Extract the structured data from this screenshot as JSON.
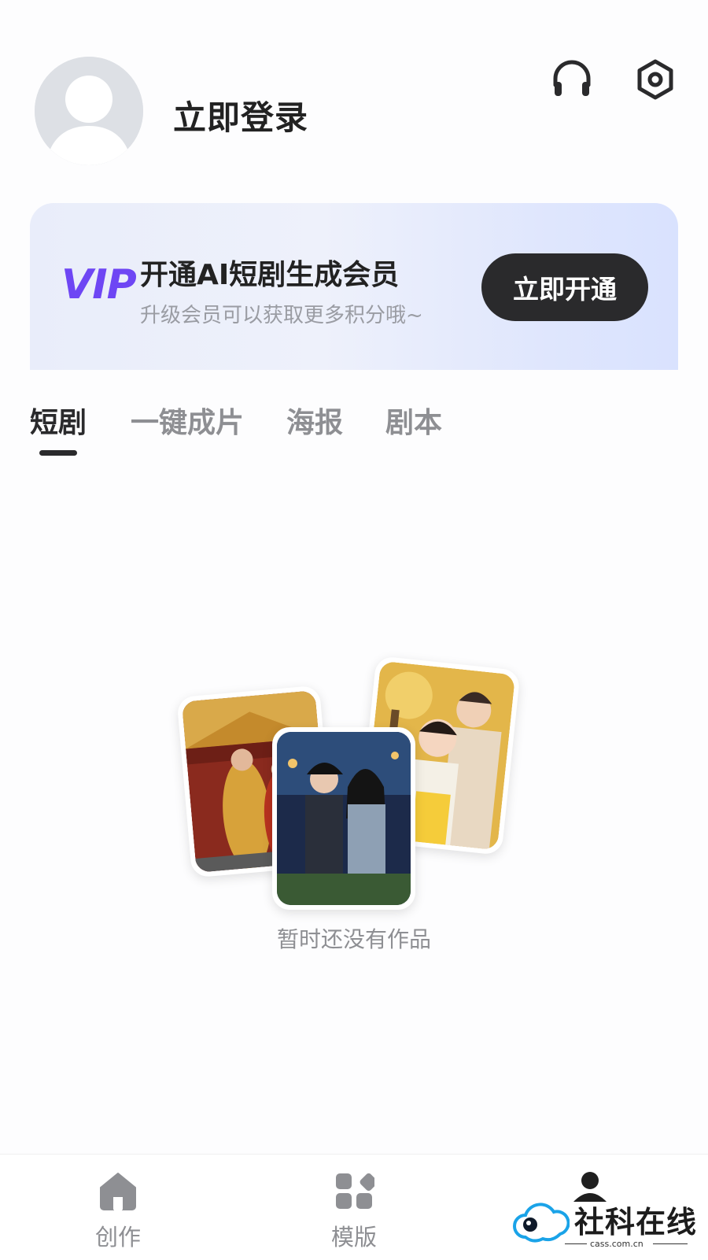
{
  "header": {
    "login_label": "立即登录",
    "icons": [
      "avatar-placeholder",
      "headset-icon",
      "settings-icon"
    ]
  },
  "vip": {
    "badge": "VIP",
    "title": "开通AI短剧生成会员",
    "subtitle": "升级会员可以获取更多积分哦~",
    "button": "立即开通",
    "accent_color": "#6e46f4",
    "button_color": "#2a2a2c"
  },
  "tabs": {
    "items": [
      "短剧",
      "一键成片",
      "海报",
      "剧本"
    ],
    "active": "短剧"
  },
  "empty_state": {
    "message": "暂时还没有作品"
  },
  "bottom_nav": {
    "items": [
      {
        "label": "创作",
        "icon": "home-icon"
      },
      {
        "label": "模版",
        "icon": "grid-icon"
      },
      {
        "label": "",
        "icon": "profile-icon",
        "active": true
      }
    ]
  },
  "watermark": {
    "text": "社科在线",
    "domain": "cass.com.cn"
  }
}
